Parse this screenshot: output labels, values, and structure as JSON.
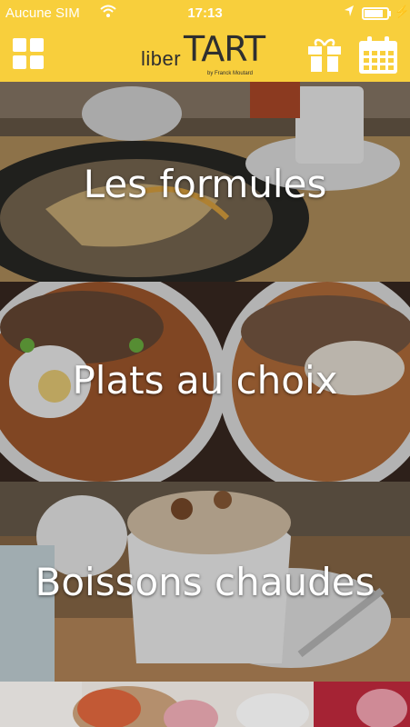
{
  "status_bar": {
    "carrier": "Aucune SIM",
    "time": "17:13",
    "battery_level": 0.85
  },
  "header": {
    "logo_text_small": "liber",
    "logo_text_big": "TART",
    "logo_tagline": "by Franck Moutard",
    "menu_icon": "grid-icon",
    "gift_icon": "gift-icon",
    "calendar_icon": "calendar-icon"
  },
  "tiles": [
    {
      "label": "Les formules"
    },
    {
      "label": "Plats au choix"
    },
    {
      "label": "Boissons chaudes"
    },
    {
      "label": ""
    }
  ],
  "colors": {
    "brand_yellow": "#f8cf3c"
  }
}
